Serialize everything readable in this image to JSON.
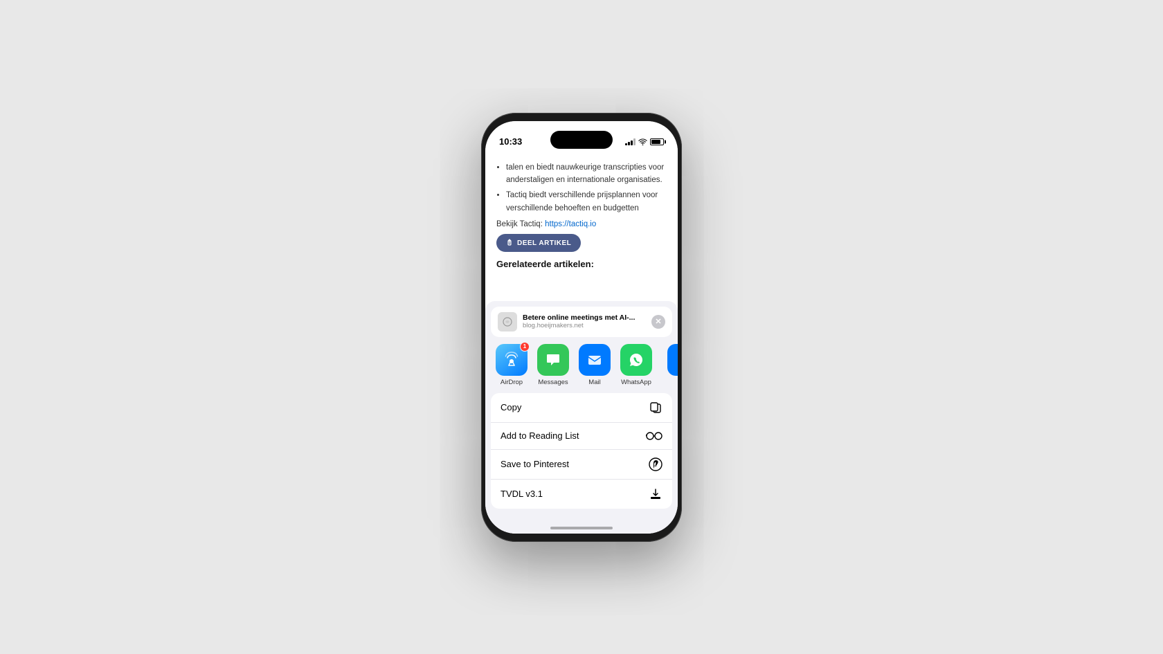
{
  "statusBar": {
    "time": "10:33",
    "batteryLevel": 80
  },
  "article": {
    "bullets": [
      "talen en biedt nauwkeurige transcripties voor anderstaligen en internationale organisaties.",
      "Tactiq biedt verschillende prijsplannen voor verschillende behoeften en budgetten"
    ],
    "linkLabel": "Bekijk Tactiq:",
    "linkUrl": "https://tactiq.io",
    "deelArtikelLabel": "DEEL ARTIKEL",
    "relatedHeading": "Gerelateerde artikelen:"
  },
  "shareSheet": {
    "preview": {
      "title": "Betere online meetings met AI-...",
      "domain": "blog.hoeijmakers.net"
    },
    "apps": [
      {
        "name": "AirDrop",
        "badge": "1"
      },
      {
        "name": "Messages",
        "badge": null
      },
      {
        "name": "Mail",
        "badge": null
      },
      {
        "name": "WhatsApp",
        "badge": null
      }
    ],
    "actions": [
      {
        "label": "Copy",
        "icon": "copy"
      },
      {
        "label": "Add to Reading List",
        "icon": "glasses"
      },
      {
        "label": "Save to Pinterest",
        "icon": "pinterest"
      },
      {
        "label": "TVDL v3.1",
        "icon": "download"
      }
    ]
  }
}
